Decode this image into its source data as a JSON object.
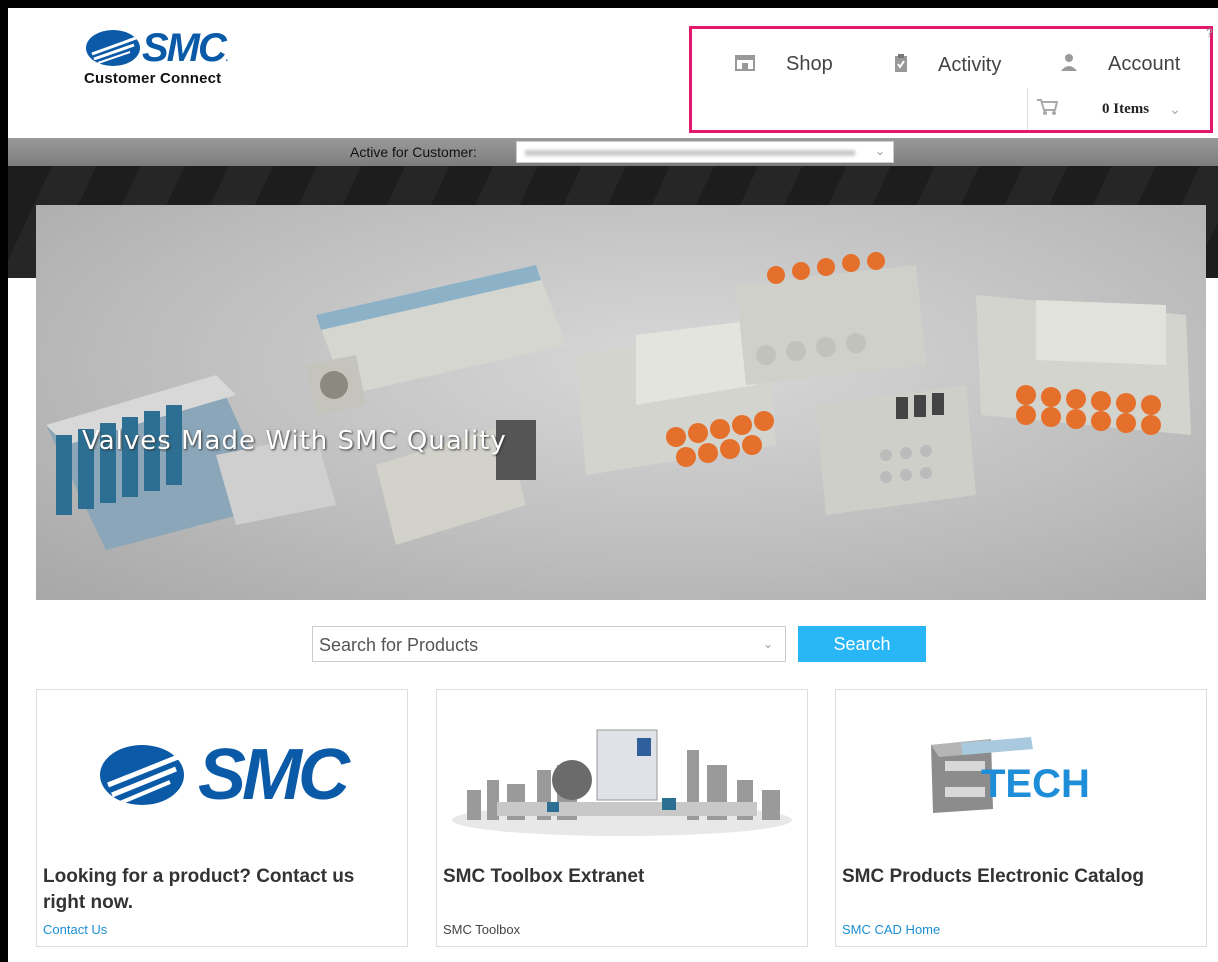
{
  "header": {
    "logo_text": "SMC",
    "logo_subtitle": "Customer Connect",
    "help_mark": "?",
    "nav": {
      "shop": "Shop",
      "activity": "Activity",
      "account": "Account"
    },
    "cart": {
      "items_label": "0 Items"
    }
  },
  "customer_bar": {
    "label": "Active for Customer:"
  },
  "banner": {
    "caption": "Valves Made With SMC Quality"
  },
  "search": {
    "placeholder": "Search for Products",
    "button_label": "Search"
  },
  "cards": [
    {
      "title": "Looking for a product? Contact us right now.",
      "link": "Contact Us",
      "logo": "SMC"
    },
    {
      "title": "SMC Toolbox Extranet",
      "link": "SMC Toolbox"
    },
    {
      "title": "SMC Products Electronic Catalog",
      "link": "SMC CAD Home",
      "logo": "TECH"
    }
  ],
  "colors": {
    "brand_blue": "#0a5aa8",
    "accent_blue": "#29b6f6",
    "highlight_pink": "#e3186d"
  }
}
